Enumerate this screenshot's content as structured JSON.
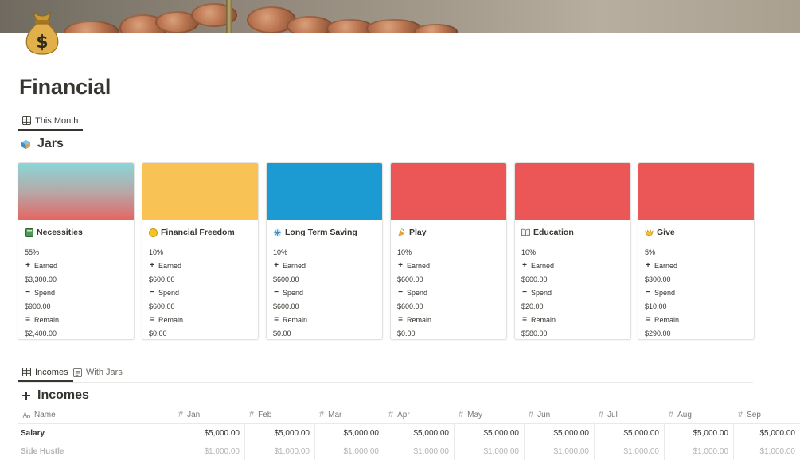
{
  "page": {
    "title": "Financial",
    "icon": "money-bag-icon"
  },
  "view_tabs": [
    {
      "label": "This Month",
      "icon": "table-icon",
      "active": true
    }
  ],
  "jars_section": {
    "title": "Jars",
    "icon": "cube-icon"
  },
  "jars": [
    {
      "name": "Necessities",
      "emoji": "green-book-icon",
      "percent": "55%",
      "earned_label": "Earned",
      "earned": "$3,300.00",
      "spend_label": "Spend",
      "spend": "$900.00",
      "remain_label": "Remain",
      "remain": "$2,400.00"
    },
    {
      "name": "Financial Freedom",
      "emoji": "coin-icon",
      "percent": "10%",
      "earned_label": "Earned",
      "earned": "$600.00",
      "spend_label": "Spend",
      "spend": "$600.00",
      "remain_label": "Remain",
      "remain": "$0.00"
    },
    {
      "name": "Long Term Saving",
      "emoji": "snowflake-icon",
      "percent": "10%",
      "earned_label": "Earned",
      "earned": "$600.00",
      "spend_label": "Spend",
      "spend": "$600.00",
      "remain_label": "Remain",
      "remain": "$0.00"
    },
    {
      "name": "Play",
      "emoji": "party-popper-icon",
      "percent": "10%",
      "earned_label": "Earned",
      "earned": "$600.00",
      "spend_label": "Spend",
      "spend": "$600.00",
      "remain_label": "Remain",
      "remain": "$0.00"
    },
    {
      "name": "Education",
      "emoji": "open-book-icon",
      "percent": "10%",
      "earned_label": "Earned",
      "earned": "$600.00",
      "spend_label": "Spend",
      "spend": "$20.00",
      "remain_label": "Remain",
      "remain": "$580.00"
    },
    {
      "name": "Give",
      "emoji": "open-hands-icon",
      "percent": "5%",
      "earned_label": "Earned",
      "earned": "$300.00",
      "spend_label": "Spend",
      "spend": "$10.00",
      "remain_label": "Remain",
      "remain": "$290.00"
    }
  ],
  "jar_colors": [
    "gradient-teal-red",
    "#f9c254",
    "#1c9bd3",
    "#eb5757",
    "#eb5757",
    "#eb5757"
  ],
  "income_tabs": [
    {
      "label": "Incomes",
      "icon": "table-icon",
      "active": true
    },
    {
      "label": "With Jars",
      "icon": "document-icon",
      "active": false
    }
  ],
  "incomes_section": {
    "title": "Incomes",
    "icon": "plus-icon"
  },
  "incomes_table": {
    "name_header": "Name",
    "months": [
      "Jan",
      "Feb",
      "Mar",
      "Apr",
      "May",
      "Jun",
      "Jul",
      "Aug",
      "Sep"
    ],
    "rows": [
      {
        "name": "Salary",
        "values": [
          "$5,000.00",
          "$5,000.00",
          "$5,000.00",
          "$5,000.00",
          "$5,000.00",
          "$5,000.00",
          "$5,000.00",
          "$5,000.00",
          "$5,000.00"
        ]
      },
      {
        "name": "Side Hustle",
        "values": [
          "$1,000.00",
          "$1,000.00",
          "$1,000.00",
          "$1,000.00",
          "$1,000.00",
          "$1,000.00",
          "$1,000.00",
          "$1,000.00",
          "$1,000.00"
        ]
      }
    ]
  }
}
